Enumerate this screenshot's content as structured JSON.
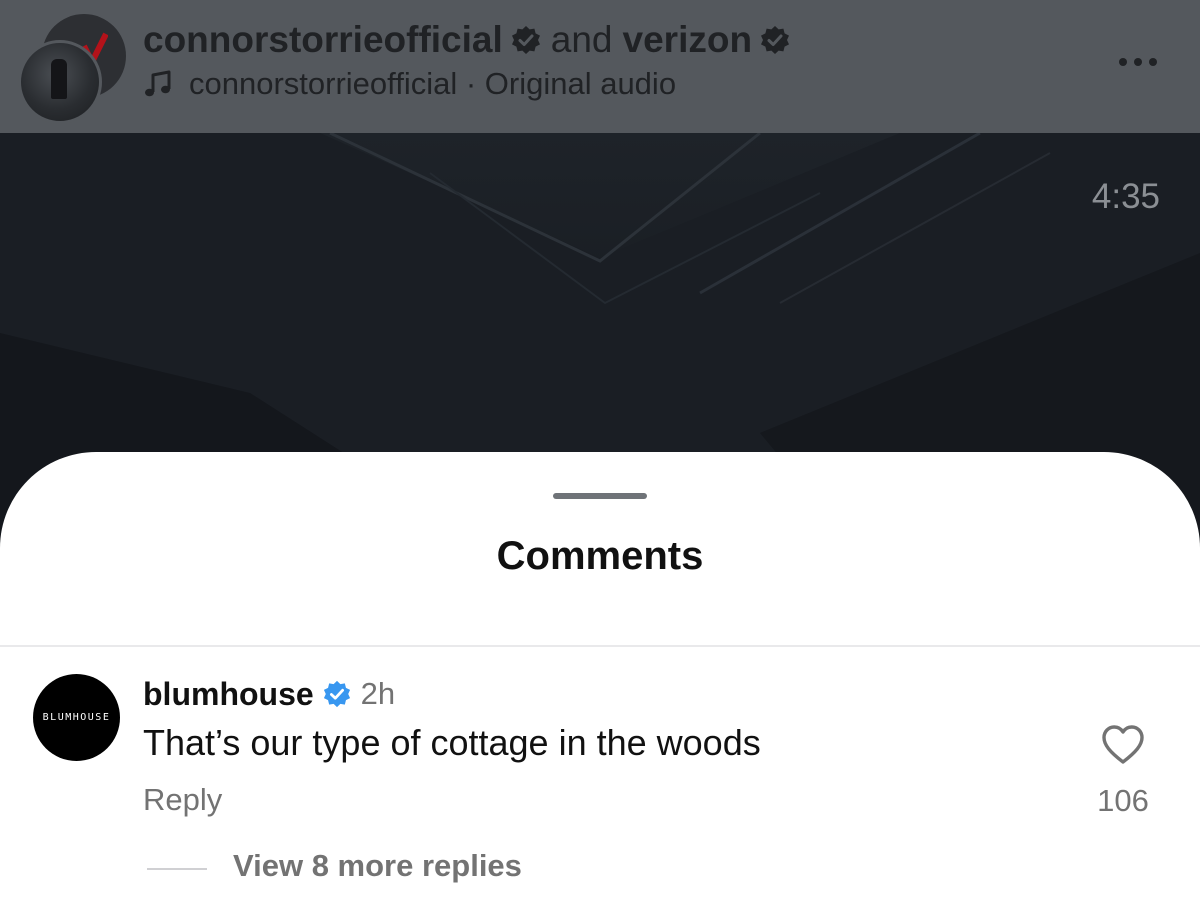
{
  "header": {
    "author_primary": "connorstorrieofficial",
    "joiner": "and",
    "author_secondary": "verizon",
    "audio_label": "connorstorrieofficial · Original audio",
    "icons": {
      "verified": "verified-badge-icon",
      "audio": "music-note-icon",
      "more": "more-options-icon"
    }
  },
  "video": {
    "time_remaining": "4:35"
  },
  "comments_sheet": {
    "title": "Comments",
    "comments": [
      {
        "username": "blumhouse",
        "avatar_logo_text": "BLUMHOUSE",
        "verified": true,
        "time_ago": "2h",
        "text": "That’s our type of cottage in the woods",
        "reply_label": "Reply",
        "like_count": "106",
        "view_replies_label": "View 8 more replies"
      }
    ]
  },
  "colors": {
    "header_bg": "#54585d",
    "video_bg": "#171b20",
    "sheet_bg": "#ffffff",
    "verified_blue": "#3897f0",
    "muted_text": "#737373"
  }
}
